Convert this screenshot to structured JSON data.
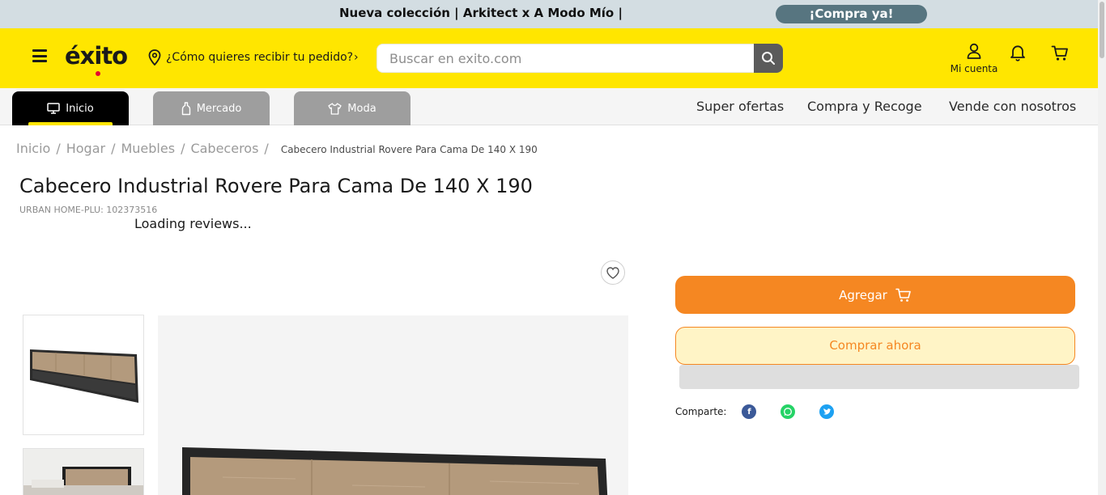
{
  "promo": {
    "text": "Nueva colección | Arkitect x A Modo Mío |",
    "cta": "¡Compra ya!"
  },
  "header": {
    "logo_text": "éxito",
    "delivery_prompt": "¿Cómo quieres recibir tu pedido?",
    "search_placeholder": "Buscar en exito.com",
    "account_label": "Mi cuenta",
    "brand_yellow": "#ffe600",
    "icons": [
      "menu-icon",
      "location-pin-icon",
      "search-icon",
      "user-icon",
      "bell-icon",
      "cart-icon"
    ]
  },
  "category_nav": {
    "tabs": [
      {
        "label": "Inicio",
        "icon": "monitor-icon",
        "active": true
      },
      {
        "label": "Mercado",
        "icon": "bottle-icon",
        "active": false
      },
      {
        "label": "Moda",
        "icon": "shirt-icon",
        "active": false
      }
    ],
    "links": [
      "Super ofertas",
      "Compra y Recoge",
      "Vende con nosotros"
    ]
  },
  "breadcrumb": {
    "items": [
      "Inicio",
      "Hogar",
      "Muebles",
      "Cabeceros"
    ],
    "separator": "/",
    "current": "Cabecero Industrial Rovere Para Cama De 140 X 190"
  },
  "product": {
    "title": "Cabecero Industrial Rovere Para Cama De 140 X 190",
    "sku": "URBAN HOME-PLU: 102373516",
    "reviews_status": "Loading reviews..."
  },
  "buy_box": {
    "add_label": "Agregar",
    "buy_now_label": "Comprar ahora",
    "share_label": "Comparte:",
    "share_icons": [
      "facebook-icon",
      "whatsapp-icon",
      "twitter-icon"
    ],
    "accent_orange": "#f58722"
  }
}
